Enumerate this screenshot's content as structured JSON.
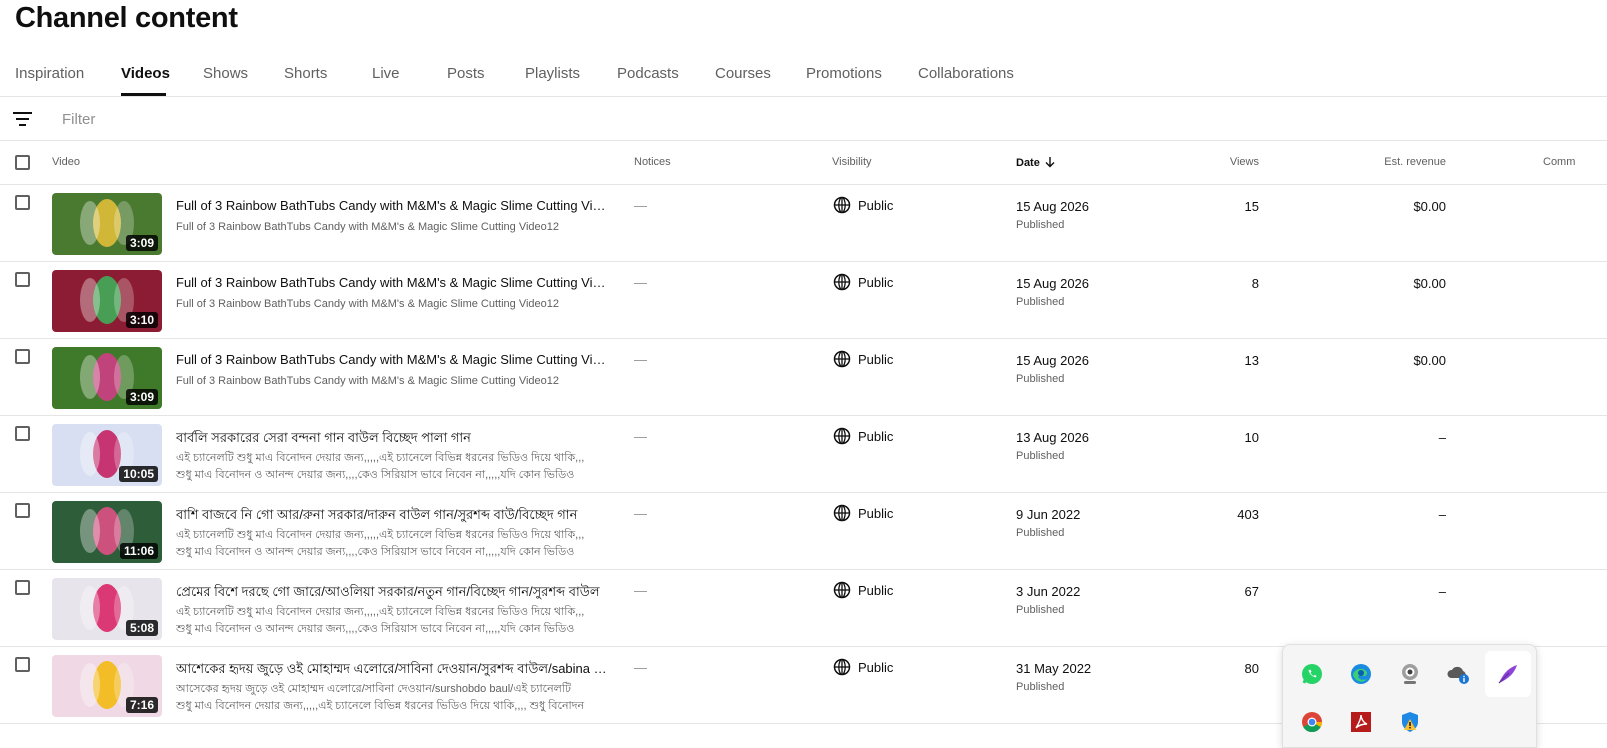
{
  "page": {
    "title": "Channel content"
  },
  "tabs": [
    {
      "label": "Inspiration",
      "active": false
    },
    {
      "label": "Videos",
      "active": true
    },
    {
      "label": "Shows",
      "active": false
    },
    {
      "label": "Shorts",
      "active": false
    },
    {
      "label": "Live",
      "active": false
    },
    {
      "label": "Posts",
      "active": false
    },
    {
      "label": "Playlists",
      "active": false
    },
    {
      "label": "Podcasts",
      "active": false
    },
    {
      "label": "Courses",
      "active": false
    },
    {
      "label": "Promotions",
      "active": false
    },
    {
      "label": "Collaborations",
      "active": false
    }
  ],
  "filter": {
    "placeholder": "Filter",
    "icon": "filter-lines-icon"
  },
  "columns": {
    "video": "Video",
    "notices": "Notices",
    "visibility": "Visibility",
    "date": "Date",
    "views": "Views",
    "revenue": "Est. revenue",
    "comments": "Comm"
  },
  "rows": [
    {
      "duration": "3:09",
      "title": "Full of 3 Rainbow BathTubs Candy with M&M's & Magic Slime Cutting Video12",
      "desc": [
        "Full of 3 Rainbow BathTubs Candy with M&M's & Magic Slime Cutting Video12"
      ],
      "notice": "—",
      "visibility": "Public",
      "date": "15 Aug 2026",
      "status": "Published",
      "views": "15",
      "revenue": "$0.00",
      "thumb_bg": "#4a7a2f",
      "thumb_accent": "#e8c23a"
    },
    {
      "duration": "3:10",
      "title": "Full of 3 Rainbow BathTubs Candy with M&M's & Magic Slime Cutting Video12",
      "desc": [
        "Full of 3 Rainbow BathTubs Candy with M&M's & Magic Slime Cutting Video12"
      ],
      "notice": "—",
      "visibility": "Public",
      "date": "15 Aug 2026",
      "status": "Published",
      "views": "8",
      "revenue": "$0.00",
      "thumb_bg": "#8c1c33",
      "thumb_accent": "#3bb55a"
    },
    {
      "duration": "3:09",
      "title": "Full of 3 Rainbow BathTubs Candy with M&M's & Magic Slime Cutting Video12",
      "desc": [
        "Full of 3 Rainbow BathTubs Candy with M&M's & Magic Slime Cutting Video12"
      ],
      "notice": "—",
      "visibility": "Public",
      "date": "15 Aug 2026",
      "status": "Published",
      "views": "13",
      "revenue": "$0.00",
      "thumb_bg": "#3f7a2a",
      "thumb_accent": "#d83a8a"
    },
    {
      "duration": "10:05",
      "title": "বার্বলি সরকারের সেরা বন্দনা গান বাউল বিচ্ছেদ পালা গান",
      "desc": [
        "এই চ্যানেলটি শুধু মাএ বিনোদন দেয়ার জন্য,,,,,এই চ্যানেলে বিভিন্ন ধরনের ভিডিও দিয়ে থাকি,,,",
        "শুধু মাএ বিনোদন ও আনন্দ দেয়ার জন্য,,,,কেও সিরিয়াস ভাবে নিবেন না,,,,,যদি কোন ভিডিও"
      ],
      "notice": "—",
      "visibility": "Public",
      "date": "13 Aug 2026",
      "status": "Published",
      "views": "10",
      "revenue": "–",
      "thumb_bg": "#d9dff2",
      "thumb_accent": "#c2185b"
    },
    {
      "duration": "11:06",
      "title": "বাশি বাজবে নি গো আর/রুনা সরকার/দারুন বাউল গান/সুরশব্দ বাউ/বিচ্ছেদ গান",
      "desc": [
        "এই চ্যানেলটি শুধু মাএ বিনোদন দেয়ার জন্য,,,,,এই চ্যানেলে বিভিন্ন ধরনের ভিডিও দিয়ে থাকি,,,",
        "শুধু মাএ বিনোদন ও আনন্দ দেয়ার জন্য,,,,কেও সিরিয়াস ভাবে নিবেন না,,,,,যদি কোন ভিডিও"
      ],
      "notice": "—",
      "visibility": "Public",
      "date": "9 Jun 2022",
      "status": "Published",
      "views": "403",
      "revenue": "–",
      "thumb_bg": "#2e5d3a",
      "thumb_accent": "#e94f8a"
    },
    {
      "duration": "5:08",
      "title": "প্রেমের বিশে দরছে গো জারে/আওলিয়া সরকার/নতুন গান/বিচ্ছেদ গান/সুরশব্দ বাউল",
      "desc": [
        "এই চ্যানেলটি শুধু মাএ বিনোদন দেয়ার জন্য,,,,,এই চ্যানেলে বিভিন্ন ধরনের ভিডিও দিয়ে থাকি,,,",
        "শুধু মাএ বিনোদন ও আনন্দ দেয়ার জন্য,,,,কেও সিরিয়াস ভাবে নিবেন না,,,,,যদি কোন ভিডিও"
      ],
      "notice": "—",
      "visibility": "Public",
      "date": "3 Jun 2022",
      "status": "Published",
      "views": "67",
      "revenue": "–",
      "thumb_bg": "#e8e4ec",
      "thumb_accent": "#d81b60"
    },
    {
      "duration": "7:16",
      "title": "আশেকের হৃদয় জুড়ে ওই মোহাম্মদ এলোরে/সাবিনা দেওয়ান/সুরশব্দ বাউল/sabina dewan",
      "desc": [
        "আসেকের হৃদয় জুড়ে ওই মোহাম্মদ এলোরে/সাবিনা দেওয়ান/surshobdo baul/এই চ্যানেলটি",
        "শুধু মাএ বিনোদন দেয়ার জন্য,,,,,এই চ্যানেলে বিভিন্ন ধরনের ভিডিও দিয়ে থাকি,,,, শুধু বিনোদন"
      ],
      "notice": "—",
      "visibility": "Public",
      "date": "31 May 2022",
      "status": "Published",
      "views": "80",
      "revenue": "",
      "thumb_bg": "#f0d9e4",
      "thumb_accent": "#f2b705"
    }
  ],
  "tray": {
    "icons": [
      "whatsapp-icon",
      "edge-icon",
      "webcam-icon",
      "onedrive-icon",
      "pen-icon",
      "chrome-icon",
      "acrobat-icon",
      "shield-warning-icon"
    ]
  }
}
